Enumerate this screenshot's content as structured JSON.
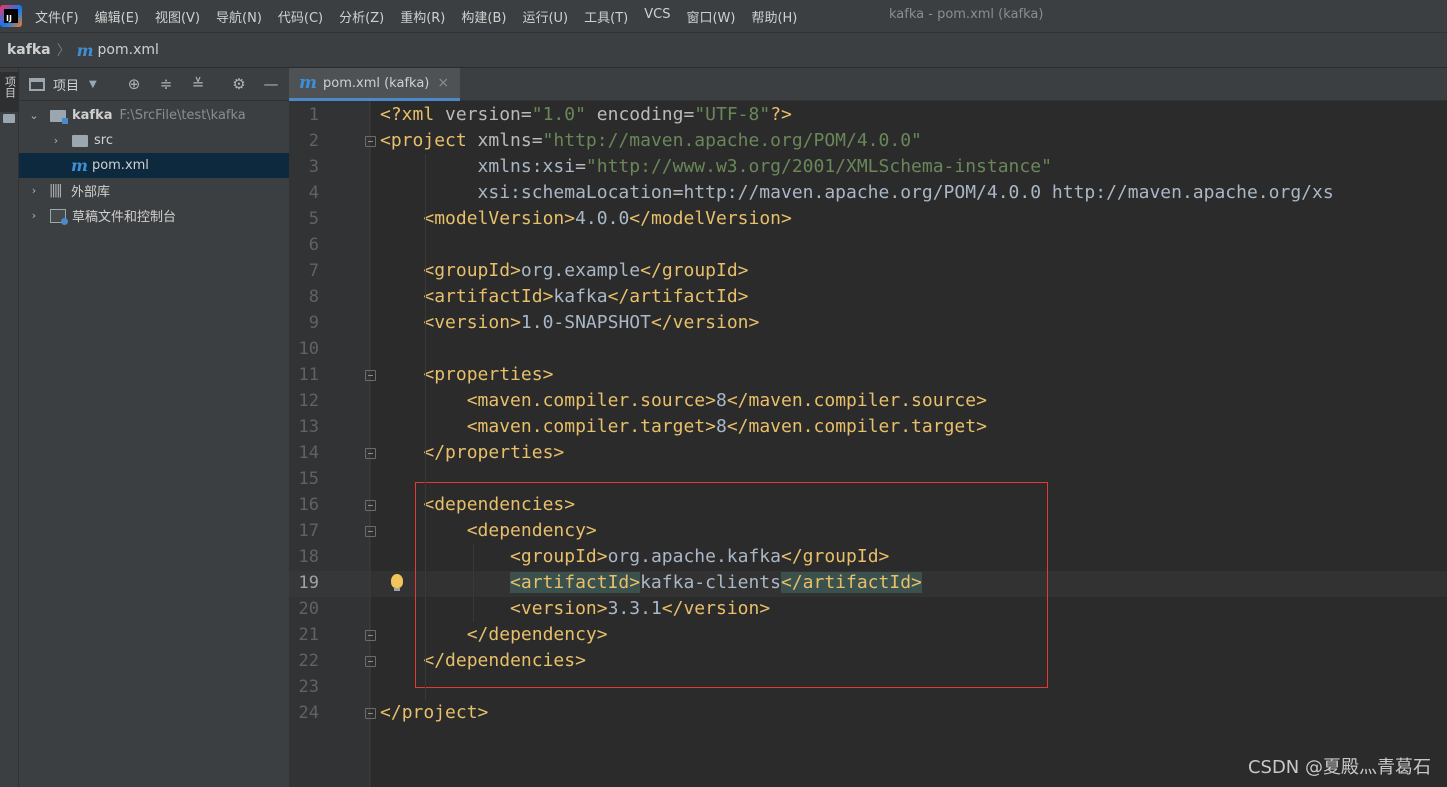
{
  "menubar": {
    "items": [
      "文件(F)",
      "编辑(E)",
      "视图(V)",
      "导航(N)",
      "代码(C)",
      "分析(Z)",
      "重构(R)",
      "构建(B)",
      "运行(U)",
      "工具(T)",
      "VCS",
      "窗口(W)",
      "帮助(H)"
    ],
    "window_title": "kafka - pom.xml (kafka)"
  },
  "breadcrumb": {
    "project": "kafka",
    "file": "pom.xml"
  },
  "left_strip": {
    "tab_label": "项目"
  },
  "project_panel": {
    "title": "项目",
    "tree": [
      {
        "label": "kafka",
        "path": "F:\\SrcFile\\test\\kafka"
      },
      {
        "label": "src"
      },
      {
        "label": "pom.xml"
      },
      {
        "label": "外部库"
      },
      {
        "label": "草稿文件和控制台"
      }
    ]
  },
  "editor": {
    "tab_label": "pom.xml (kafka)",
    "current_line": 19,
    "lines": [
      "<?xml version=\"1.0\" encoding=\"UTF-8\"?>",
      "<project xmlns=\"http://maven.apache.org/POM/4.0.0\"",
      "         xmlns:xsi=\"http://www.w3.org/2001/XMLSchema-instance\"",
      "         xsi:schemaLocation=\"http://maven.apache.org/POM/4.0.0 http://maven.apache.org/xs",
      "    <modelVersion>4.0.0</modelVersion>",
      "",
      "    <groupId>org.example</groupId>",
      "    <artifactId>kafka</artifactId>",
      "    <version>1.0-SNAPSHOT</version>",
      "",
      "    <properties>",
      "        <maven.compiler.source>8</maven.compiler.source>",
      "        <maven.compiler.target>8</maven.compiler.target>",
      "    </properties>",
      "",
      "    <dependencies>",
      "        <dependency>",
      "            <groupId>org.apache.kafka</groupId>",
      "            <artifactId>kafka-clients</artifactId>",
      "            <version>3.3.1</version>",
      "        </dependency>",
      "    </dependencies>",
      "",
      "</project>"
    ]
  },
  "watermark": "CSDN @夏殿灬青葛石",
  "colors": {
    "accent": "#4a88c7",
    "highlight_box": "#e53935",
    "tag": "#e8bf6a",
    "string": "#6a8759"
  }
}
